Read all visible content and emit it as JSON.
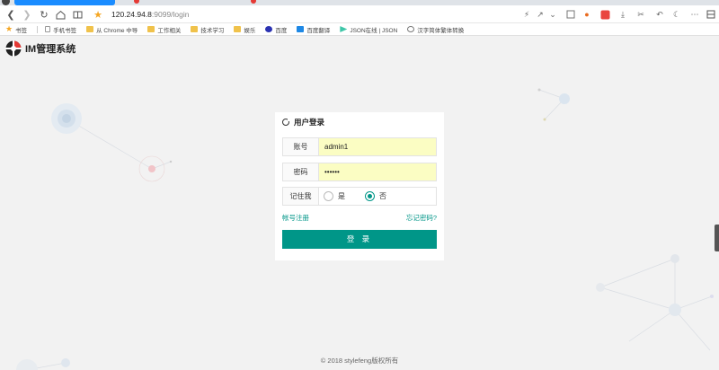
{
  "browser": {
    "tabs": [
      {
        "label": "",
        "active": true
      },
      {
        "label": "",
        "active": false
      },
      {
        "label": "",
        "active": false
      }
    ],
    "url_host": "120.24.94.8",
    "url_path": ":9099/login",
    "bookmarks": [
      {
        "icon": "star-icon",
        "label": "书签"
      },
      {
        "icon": "file-icon",
        "label": "手机书签"
      },
      {
        "icon": "folder-icon",
        "label": "从 Chrome 中导"
      },
      {
        "icon": "folder-icon",
        "label": "工作相关"
      },
      {
        "icon": "folder-icon",
        "label": "技术学习"
      },
      {
        "icon": "folder-icon",
        "label": "娱乐"
      },
      {
        "icon": "baidu-icon",
        "label": "百度"
      },
      {
        "icon": "translate-icon",
        "label": "百度翻译"
      },
      {
        "icon": "json-icon",
        "label": "JSON在线 | JSON"
      },
      {
        "icon": "globe-icon",
        "label": "汉字简体繁体转换"
      }
    ]
  },
  "app": {
    "title": "IM管理系统"
  },
  "login": {
    "title": "用户登录",
    "account_label": "账号",
    "account_value": "admin1",
    "password_label": "密码",
    "password_value": "••••••",
    "remember_label": "记住我",
    "yes_label": "是",
    "no_label": "否",
    "register_link": "帐号注册",
    "forgot_link": "忘记密码?",
    "submit_label": "登 录"
  },
  "footer": {
    "text": "© 2018  stylefeng版权所有"
  },
  "colors": {
    "accent": "#009688",
    "autofill": "#fbfdc3",
    "background": "#f2f2f2"
  }
}
